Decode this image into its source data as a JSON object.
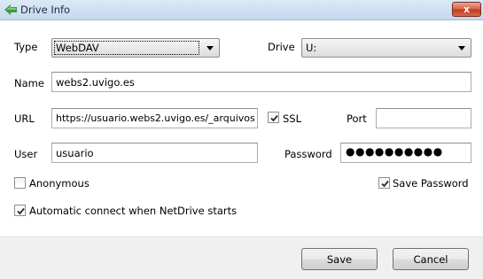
{
  "window": {
    "title": "Drive Info",
    "close_label": "x"
  },
  "form": {
    "type_label": "Type",
    "type_value": "WebDAV",
    "drive_label": "Drive",
    "drive_value": "U:",
    "name_label": "Name",
    "name_value": "webs2.uvigo.es",
    "url_label": "URL",
    "url_value": "https://usuario.webs2.uvigo.es/_arquivos",
    "ssl_label": "SSL",
    "ssl_checked": true,
    "port_label": "Port",
    "port_value": "",
    "user_label": "User",
    "user_value": "usuario",
    "password_label": "Password",
    "password_value": "●●●●●●●●●●",
    "anonymous_label": "Anonymous",
    "anonymous_checked": false,
    "save_password_label": "Save Password",
    "save_password_checked": true,
    "auto_connect_label": "Automatic connect when NetDrive starts",
    "auto_connect_checked": true
  },
  "buttons": {
    "save": "Save",
    "cancel": "Cancel"
  },
  "colors": {
    "titlebar": "#c6d8ee",
    "close_button": "#c13b21",
    "footer": "#f0f0f0"
  }
}
